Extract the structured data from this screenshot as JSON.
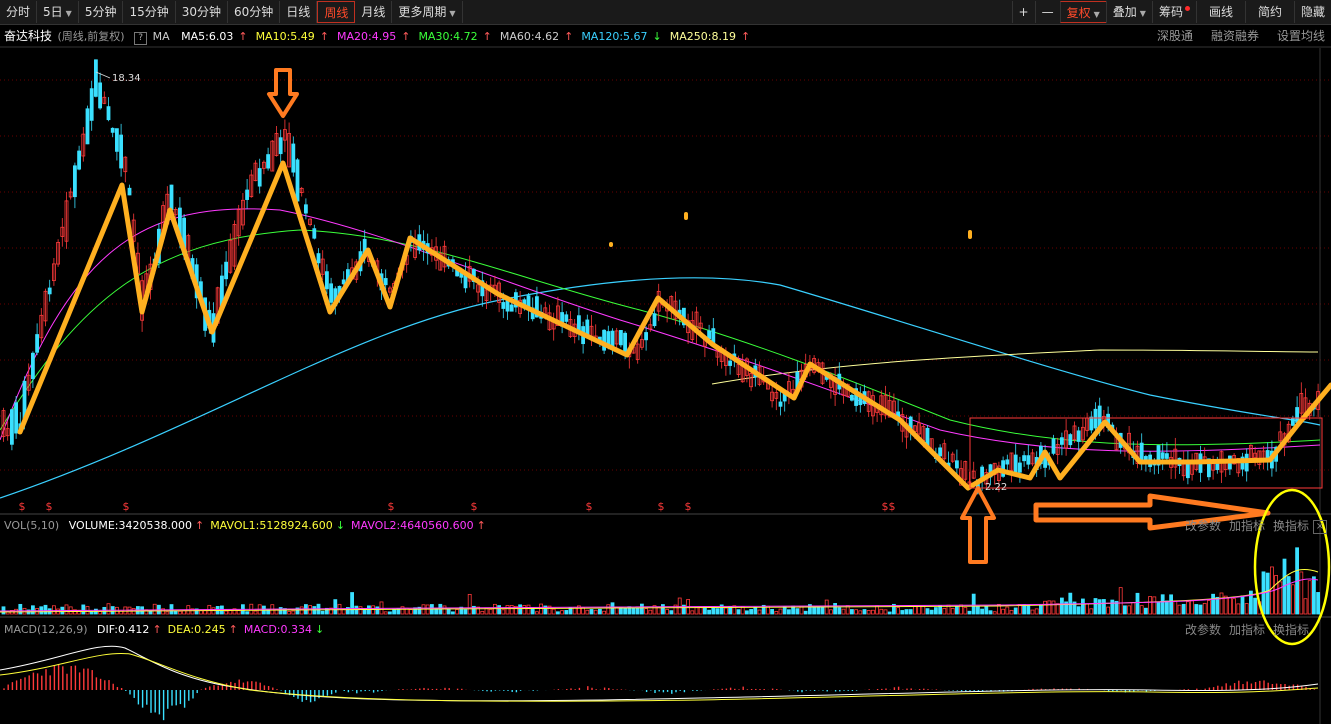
{
  "toolbar": {
    "tabs": [
      {
        "label": "分时",
        "caret": false,
        "active": false
      },
      {
        "label": "5日",
        "caret": true,
        "active": false
      },
      {
        "label": "5分钟",
        "caret": false,
        "active": false
      },
      {
        "label": "15分钟",
        "caret": false,
        "active": false
      },
      {
        "label": "30分钟",
        "caret": false,
        "active": false
      },
      {
        "label": "60分钟",
        "caret": false,
        "active": false
      },
      {
        "label": "日线",
        "caret": false,
        "active": false
      },
      {
        "label": "周线",
        "caret": false,
        "active": true
      },
      {
        "label": "月线",
        "caret": false,
        "active": false
      },
      {
        "label": "更多周期",
        "caret": true,
        "active": false
      }
    ],
    "right": {
      "plus": "+",
      "minus": "—",
      "fuquan": "复权",
      "diejia": "叠加",
      "chouma": "筹码",
      "huaxian": "画线",
      "jianyue": "简约",
      "yincang": "隐藏"
    }
  },
  "info": {
    "stock_name": "奋达科技",
    "period_note": "(周线,前复权)",
    "help": "?",
    "ma_label": "MA",
    "ma": [
      {
        "label": "MA5:6.03",
        "color": "#ffffff",
        "arrow": "↑"
      },
      {
        "label": "MA10:5.49",
        "color": "#ffff3a",
        "arrow": "↑"
      },
      {
        "label": "MA20:4.95",
        "color": "#ff3aff",
        "arrow": "↑"
      },
      {
        "label": "MA30:4.72",
        "color": "#3aff3a",
        "arrow": "↑"
      },
      {
        "label": "MA60:4.62",
        "color": "#cccccc",
        "arrow": "↑"
      },
      {
        "label": "MA120:5.67",
        "color": "#3ad0ff",
        "arrow": "↓"
      },
      {
        "label": "MA250:8.19",
        "color": "#ffff9a",
        "arrow": "↑"
      }
    ],
    "links": [
      "深股通",
      "融资融券",
      "设置均线"
    ]
  },
  "price_labels": {
    "high": "18.34",
    "low": "2.22"
  },
  "vol_bar": {
    "name": "VOL(5,10)",
    "items": [
      {
        "label": "VOLUME:3420538.000",
        "color": "#ffffff",
        "arrow": "↑"
      },
      {
        "label": "MAVOL1:5128924.600",
        "color": "#ffff3a",
        "arrow": "↓"
      },
      {
        "label": "MAVOL2:4640560.600",
        "color": "#ff3aff",
        "arrow": "↑"
      }
    ],
    "right": [
      "改参数",
      "加指标",
      "换指标"
    ],
    "close": "×"
  },
  "macd_bar": {
    "name": "MACD(12,26,9)",
    "items": [
      {
        "label": "DIF:0.412",
        "color": "#ffffff",
        "arrow": "↑"
      },
      {
        "label": "DEA:0.245",
        "color": "#ffff3a",
        "arrow": "↑"
      },
      {
        "label": "MACD:0.334",
        "color": "#ff3aff",
        "arrow": "↓"
      }
    ],
    "right": [
      "改参数",
      "加指标",
      "换指标"
    ]
  },
  "colors": {
    "up": "#ff3a3a",
    "down": "#3ae0ff",
    "annotation": "#ffb020",
    "arrow": "#ff7a20",
    "ellipse": "#ffff00",
    "ma120": "#3ad0ff",
    "ma250": "#ffff9a"
  }
}
